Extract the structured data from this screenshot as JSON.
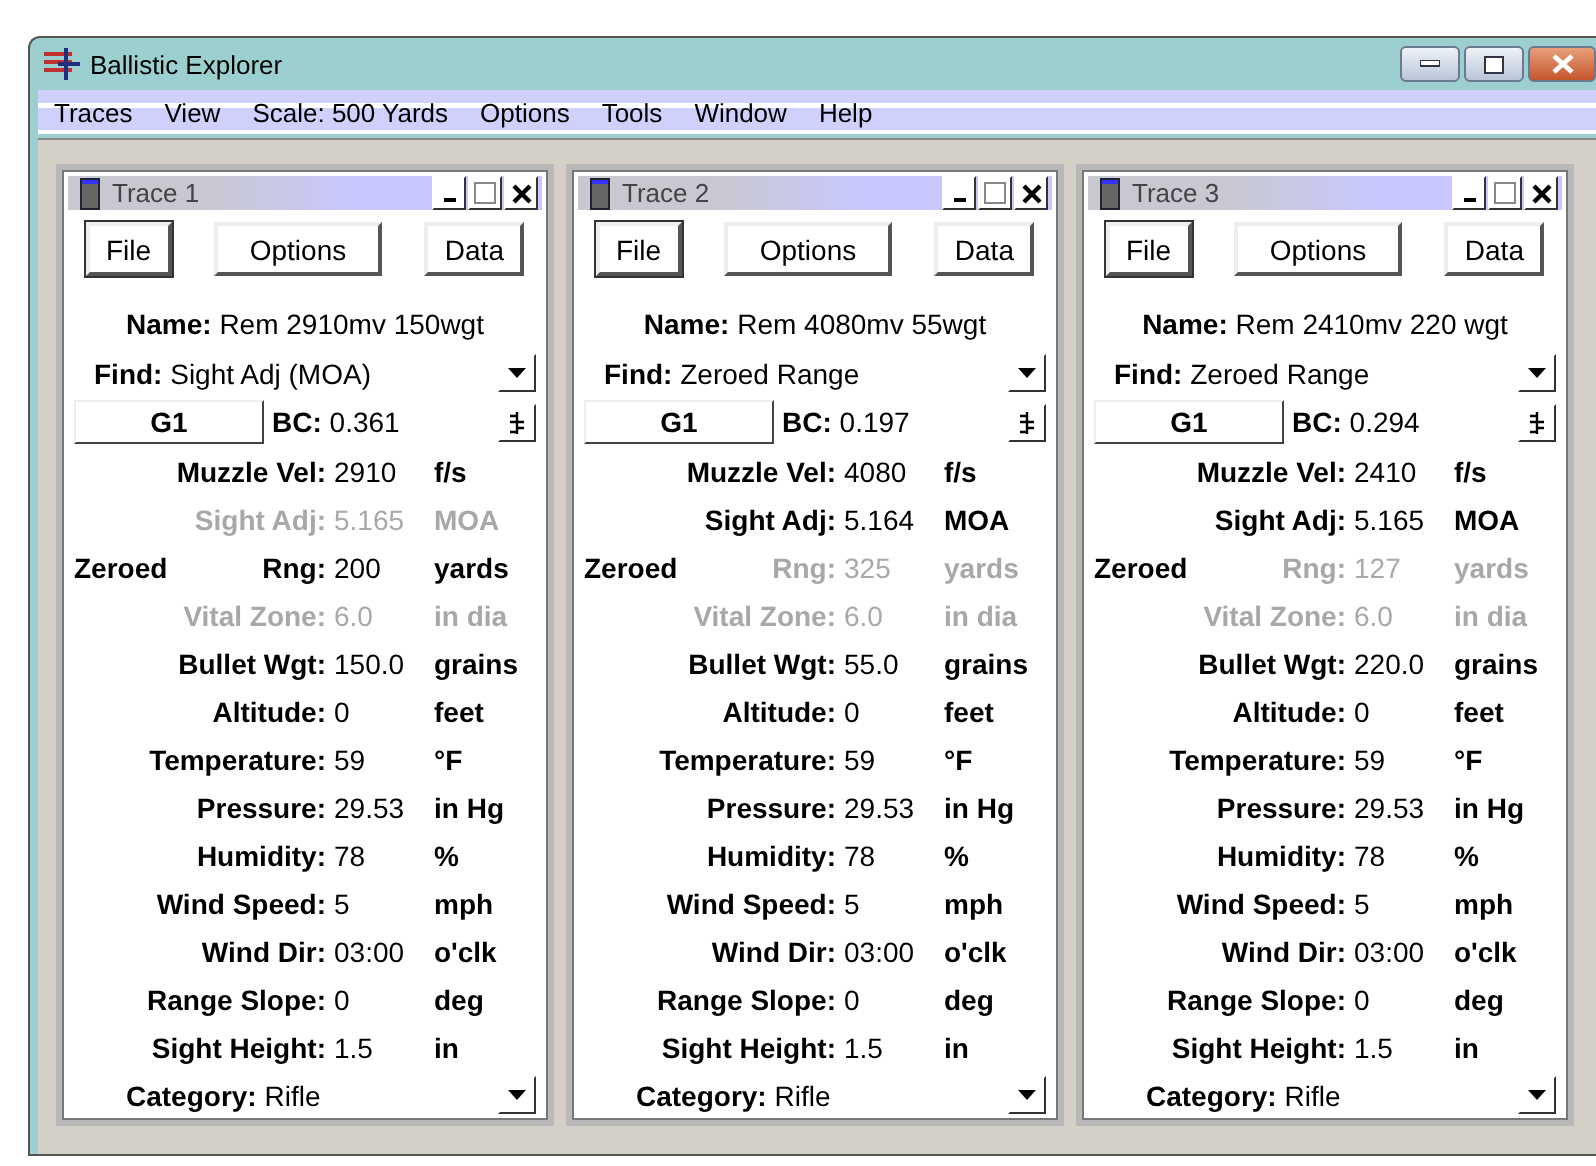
{
  "window": {
    "title": "Ballistic Explorer"
  },
  "menu": [
    "Traces",
    "View",
    "Scale: 500 Yards",
    "Options",
    "Tools",
    "Window",
    "Help"
  ],
  "traces": [
    {
      "title": "Trace 1",
      "buttons": [
        "File",
        "Options",
        "Data"
      ],
      "name_label": "Name:",
      "name": "Rem 2910mv 150wgt",
      "find_label": "Find:",
      "find": "Sight Adj (MOA)",
      "model": "G1",
      "bc_label": "BC:",
      "bc": "0.361",
      "category_label": "Category:",
      "category": "Rifle",
      "fields": [
        {
          "kind": "field",
          "label": "Muzzle Vel:",
          "value": "2910",
          "unit": "f/s",
          "disabled": false
        },
        {
          "kind": "field",
          "label": "Sight Adj:",
          "value": "5.165",
          "unit": "MOA",
          "disabled": true
        },
        {
          "kind": "zeroed",
          "prefix": "Zeroed",
          "label": "Rng:",
          "value": "200",
          "unit": "yards",
          "disabled": false
        },
        {
          "kind": "field",
          "label": "Vital Zone:",
          "value": "6.0",
          "unit": "in dia",
          "disabled": true
        },
        {
          "kind": "field",
          "label": "Bullet Wgt:",
          "value": "150.0",
          "unit": "grains",
          "disabled": false
        },
        {
          "kind": "field",
          "label": "Altitude:",
          "value": "0",
          "unit": "feet",
          "disabled": false
        },
        {
          "kind": "field",
          "label": "Temperature:",
          "value": "59",
          "unit": "°F",
          "disabled": false
        },
        {
          "kind": "field",
          "label": "Pressure:",
          "value": "29.53",
          "unit": "in Hg",
          "disabled": false
        },
        {
          "kind": "field",
          "label": "Humidity:",
          "value": "78",
          "unit": "%",
          "disabled": false
        },
        {
          "kind": "field",
          "label": "Wind Speed:",
          "value": "5",
          "unit": "mph",
          "disabled": false
        },
        {
          "kind": "field",
          "label": "Wind Dir:",
          "value": "03:00",
          "unit": "o'clk",
          "disabled": false
        },
        {
          "kind": "field",
          "label": "Range Slope:",
          "value": "0",
          "unit": "deg",
          "disabled": false
        },
        {
          "kind": "field",
          "label": "Sight Height:",
          "value": "1.5",
          "unit": "in",
          "disabled": false
        }
      ]
    },
    {
      "title": "Trace 2",
      "buttons": [
        "File",
        "Options",
        "Data"
      ],
      "name_label": "Name:",
      "name": "Rem 4080mv 55wgt",
      "find_label": "Find:",
      "find": "Zeroed Range",
      "model": "G1",
      "bc_label": "BC:",
      "bc": "0.197",
      "category_label": "Category:",
      "category": "Rifle",
      "fields": [
        {
          "kind": "field",
          "label": "Muzzle Vel:",
          "value": "4080",
          "unit": "f/s",
          "disabled": false
        },
        {
          "kind": "field",
          "label": "Sight Adj:",
          "value": "5.164",
          "unit": "MOA",
          "disabled": false
        },
        {
          "kind": "zeroed",
          "prefix": "Zeroed",
          "label": "Rng:",
          "value": "325",
          "unit": "yards",
          "disabled": true
        },
        {
          "kind": "field",
          "label": "Vital Zone:",
          "value": "6.0",
          "unit": "in dia",
          "disabled": true
        },
        {
          "kind": "field",
          "label": "Bullet Wgt:",
          "value": "55.0",
          "unit": "grains",
          "disabled": false
        },
        {
          "kind": "field",
          "label": "Altitude:",
          "value": "0",
          "unit": "feet",
          "disabled": false
        },
        {
          "kind": "field",
          "label": "Temperature:",
          "value": "59",
          "unit": "°F",
          "disabled": false
        },
        {
          "kind": "field",
          "label": "Pressure:",
          "value": "29.53",
          "unit": "in Hg",
          "disabled": false
        },
        {
          "kind": "field",
          "label": "Humidity:",
          "value": "78",
          "unit": "%",
          "disabled": false
        },
        {
          "kind": "field",
          "label": "Wind Speed:",
          "value": "5",
          "unit": "mph",
          "disabled": false
        },
        {
          "kind": "field",
          "label": "Wind Dir:",
          "value": "03:00",
          "unit": "o'clk",
          "disabled": false
        },
        {
          "kind": "field",
          "label": "Range Slope:",
          "value": "0",
          "unit": "deg",
          "disabled": false
        },
        {
          "kind": "field",
          "label": "Sight Height:",
          "value": "1.5",
          "unit": "in",
          "disabled": false
        }
      ]
    },
    {
      "title": "Trace 3",
      "buttons": [
        "File",
        "Options",
        "Data"
      ],
      "name_label": "Name:",
      "name": "Rem 2410mv 220 wgt",
      "find_label": "Find:",
      "find": "Zeroed Range",
      "model": "G1",
      "bc_label": "BC:",
      "bc": "0.294",
      "category_label": "Category:",
      "category": "Rifle",
      "fields": [
        {
          "kind": "field",
          "label": "Muzzle Vel:",
          "value": "2410",
          "unit": "f/s",
          "disabled": false
        },
        {
          "kind": "field",
          "label": "Sight Adj:",
          "value": "5.165",
          "unit": "MOA",
          "disabled": false
        },
        {
          "kind": "zeroed",
          "prefix": "Zeroed",
          "label": "Rng:",
          "value": "127",
          "unit": "yards",
          "disabled": true
        },
        {
          "kind": "field",
          "label": "Vital Zone:",
          "value": "6.0",
          "unit": "in dia",
          "disabled": true
        },
        {
          "kind": "field",
          "label": "Bullet Wgt:",
          "value": "220.0",
          "unit": "grains",
          "disabled": false
        },
        {
          "kind": "field",
          "label": "Altitude:",
          "value": "0",
          "unit": "feet",
          "disabled": false
        },
        {
          "kind": "field",
          "label": "Temperature:",
          "value": "59",
          "unit": "°F",
          "disabled": false
        },
        {
          "kind": "field",
          "label": "Pressure:",
          "value": "29.53",
          "unit": "in Hg",
          "disabled": false
        },
        {
          "kind": "field",
          "label": "Humidity:",
          "value": "78",
          "unit": "%",
          "disabled": false
        },
        {
          "kind": "field",
          "label": "Wind Speed:",
          "value": "5",
          "unit": "mph",
          "disabled": false
        },
        {
          "kind": "field",
          "label": "Wind Dir:",
          "value": "03:00",
          "unit": "o'clk",
          "disabled": false
        },
        {
          "kind": "field",
          "label": "Range Slope:",
          "value": "0",
          "unit": "deg",
          "disabled": false
        },
        {
          "kind": "field",
          "label": "Sight Height:",
          "value": "1.5",
          "unit": "in",
          "disabled": false
        }
      ]
    }
  ]
}
